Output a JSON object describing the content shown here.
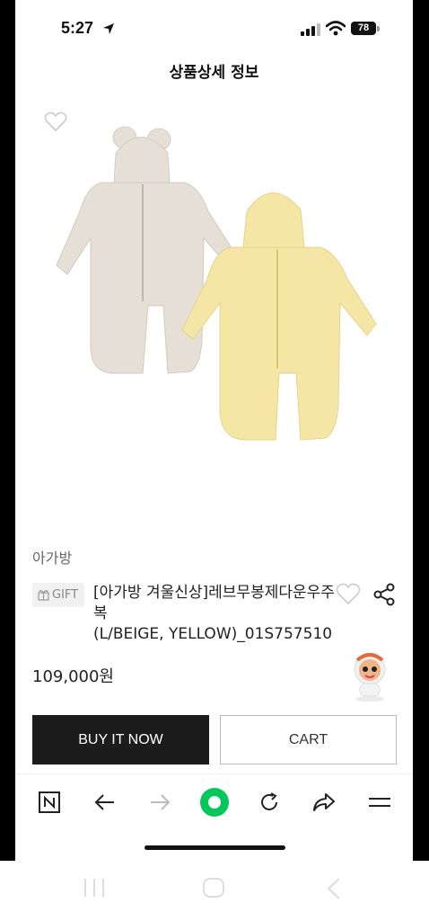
{
  "status_bar": {
    "time": "5:27",
    "battery": "78"
  },
  "header": {
    "title": "상품상세 정보"
  },
  "product": {
    "brand": "아가방",
    "gift_badge": "GIFT",
    "name_line1": "[아가방 겨울신상]레브무봉제다운우주",
    "name_line2": "복",
    "name_line3": "(L/BEIGE, YELLOW)_01S757510",
    "price": "109,000원",
    "image_colors": {
      "beige": "#e6dfd6",
      "yellow": "#f5e6a6"
    }
  },
  "actions": {
    "buy_now": "BUY IT NOW",
    "cart": "CART"
  },
  "browser_toolbar": {
    "icons": [
      "naver-icon",
      "back-arrow-icon",
      "forward-arrow-icon",
      "green-dot-icon",
      "refresh-icon",
      "share-arrow-icon",
      "menu-icon"
    ],
    "accent": "#03c75a"
  },
  "android_nav": {
    "icons": [
      "recents-icon",
      "home-icon",
      "back-icon"
    ]
  }
}
